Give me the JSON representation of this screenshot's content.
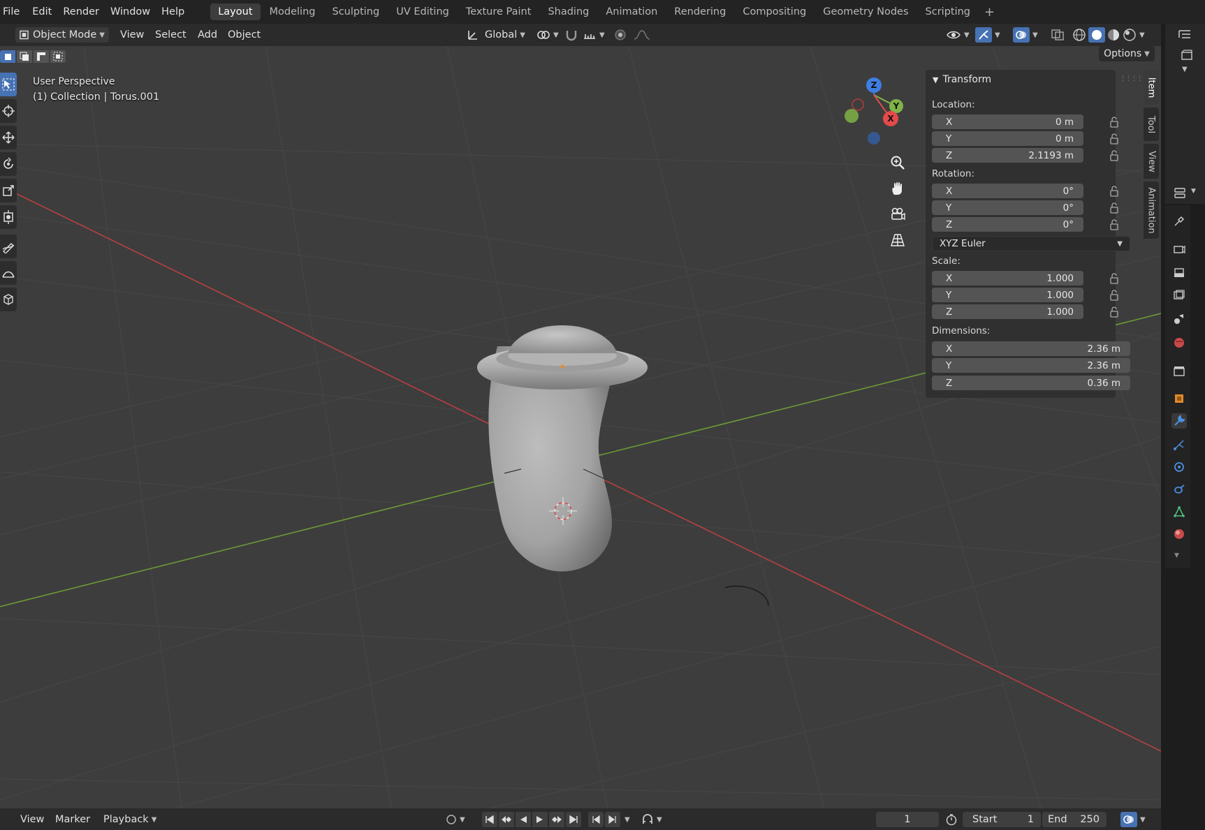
{
  "menu": [
    "File",
    "Edit",
    "Render",
    "Window",
    "Help"
  ],
  "workspaces": [
    "Layout",
    "Modeling",
    "Sculpting",
    "UV Editing",
    "Texture Paint",
    "Shading",
    "Animation",
    "Rendering",
    "Compositing",
    "Geometry Nodes",
    "Scripting"
  ],
  "active_workspace": "Layout",
  "header": {
    "mode": "Object Mode",
    "view": "View",
    "select": "Select",
    "add": "Add",
    "object": "Object",
    "orientation": "Global",
    "options": "Options"
  },
  "viewport": {
    "view_name": "User Perspective",
    "collection_info": "(1) Collection | Torus.001"
  },
  "gizmo": {
    "z": "Z",
    "y": "Y",
    "x": "X"
  },
  "npanel": {
    "title": "Transform",
    "location_label": "Location:",
    "location": [
      {
        "axis": "X",
        "value": "0 m"
      },
      {
        "axis": "Y",
        "value": "0 m"
      },
      {
        "axis": "Z",
        "value": "2.1193 m"
      }
    ],
    "rotation_label": "Rotation:",
    "rotation": [
      {
        "axis": "X",
        "value": "0°"
      },
      {
        "axis": "Y",
        "value": "0°"
      },
      {
        "axis": "Z",
        "value": "0°"
      }
    ],
    "rotation_mode": "XYZ Euler",
    "scale_label": "Scale:",
    "scale": [
      {
        "axis": "X",
        "value": "1.000"
      },
      {
        "axis": "Y",
        "value": "1.000"
      },
      {
        "axis": "Z",
        "value": "1.000"
      }
    ],
    "dimensions_label": "Dimensions:",
    "dimensions": [
      {
        "axis": "X",
        "value": "2.36 m"
      },
      {
        "axis": "Y",
        "value": "2.36 m"
      },
      {
        "axis": "Z",
        "value": "0.36 m"
      }
    ]
  },
  "sidebar_tabs": [
    "Item",
    "Tool",
    "View",
    "Animation"
  ],
  "timeline": {
    "view": "View",
    "marker": "Marker",
    "playback": "Playback",
    "current_frame": "1",
    "start_label": "Start",
    "start_value": "1",
    "end_label": "End",
    "end_value": "250"
  },
  "colors": {
    "accent": "#4772b3",
    "axis_x": "#e34a4a",
    "axis_y": "#7fb347",
    "axis_z": "#3d7ee0",
    "viewport_bg": "#3d3d3d"
  }
}
